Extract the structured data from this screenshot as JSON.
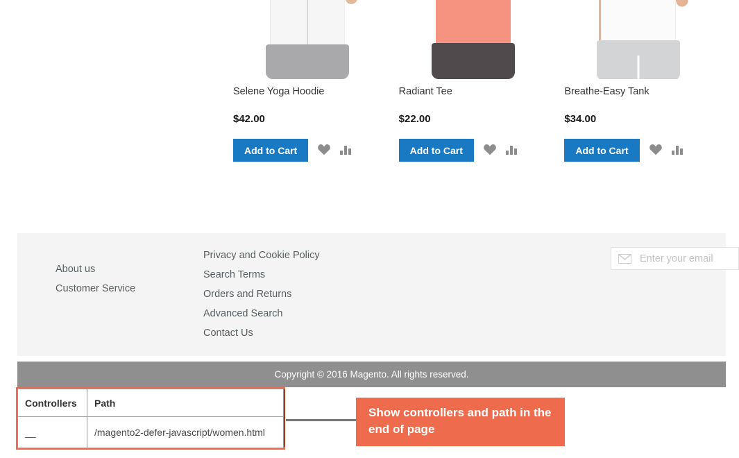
{
  "products": [
    {
      "name": "Selene Yoga Hoodie",
      "price": "$42.00",
      "add_to_cart_label": "Add to Cart",
      "wishlist_icon": "heart-icon",
      "compare_icon": "compare-bars-icon"
    },
    {
      "name": "Radiant Tee",
      "price": "$22.00",
      "add_to_cart_label": "Add to Cart",
      "wishlist_icon": "heart-icon",
      "compare_icon": "compare-bars-icon"
    },
    {
      "name": "Breathe-Easy Tank",
      "price": "$34.00",
      "add_to_cart_label": "Add to Cart",
      "wishlist_icon": "heart-icon",
      "compare_icon": "compare-bars-icon"
    }
  ],
  "footer": {
    "column_a": [
      "About us",
      "Customer Service"
    ],
    "column_b": [
      "Privacy and Cookie Policy",
      "Search Terms",
      "Orders and Returns",
      "Advanced Search",
      "Contact Us"
    ],
    "newsletter": {
      "icon": "envelope-icon",
      "placeholder": "Enter your email",
      "value": ""
    },
    "copyright": "Copyright © 2016 Magento. All rights reserved."
  },
  "debug_table": {
    "headers": [
      "Controllers",
      "Path"
    ],
    "rows": [
      [
        "__",
        "/magento2-defer-javascript/women.html"
      ]
    ]
  },
  "annotation": {
    "text": "Show controllers and path in the end of page",
    "color": "#ee6b4d"
  },
  "colors": {
    "primary_button": "#1979c3",
    "footer_background": "#f4f4f4",
    "copyright_background": "#8f8f8f",
    "annotation": "#ee6b4d"
  }
}
